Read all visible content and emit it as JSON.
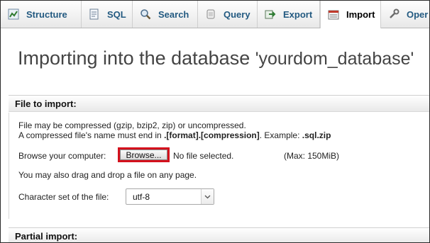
{
  "tabs": [
    {
      "label": "Structure",
      "icon": "structure-icon"
    },
    {
      "label": "SQL",
      "icon": "sql-icon"
    },
    {
      "label": "Search",
      "icon": "search-icon"
    },
    {
      "label": "Query",
      "icon": "query-icon"
    },
    {
      "label": "Export",
      "icon": "export-icon"
    },
    {
      "label": "Import",
      "icon": "import-icon",
      "active": true
    },
    {
      "label": "Oper",
      "icon": "operations-icon"
    }
  ],
  "page": {
    "title": "Importing into the database",
    "database": "'yourdom_database'"
  },
  "file_import": {
    "legend": "File to import:",
    "note_line1": "File may be compressed (gzip, bzip2, zip) or uncompressed.",
    "note_line2_pre": "A compressed file's name must end in ",
    "note_line2_pattern": ".[format].[compression]",
    "note_line2_mid": ". Example: ",
    "note_line2_example": ".sql.zip",
    "browse_label": "Browse your computer:",
    "browse_button": "Browse...",
    "file_status": "No file selected.",
    "max_size": "(Max: 150MiB)",
    "drag_hint": "You may also drag and drop a file on any page.",
    "charset_label": "Character set of the file:",
    "charset_value": "utf-8"
  },
  "partial_import": {
    "legend": "Partial import:"
  },
  "colors": {
    "tab_text": "#235a81",
    "highlight_border": "#d4111d"
  }
}
